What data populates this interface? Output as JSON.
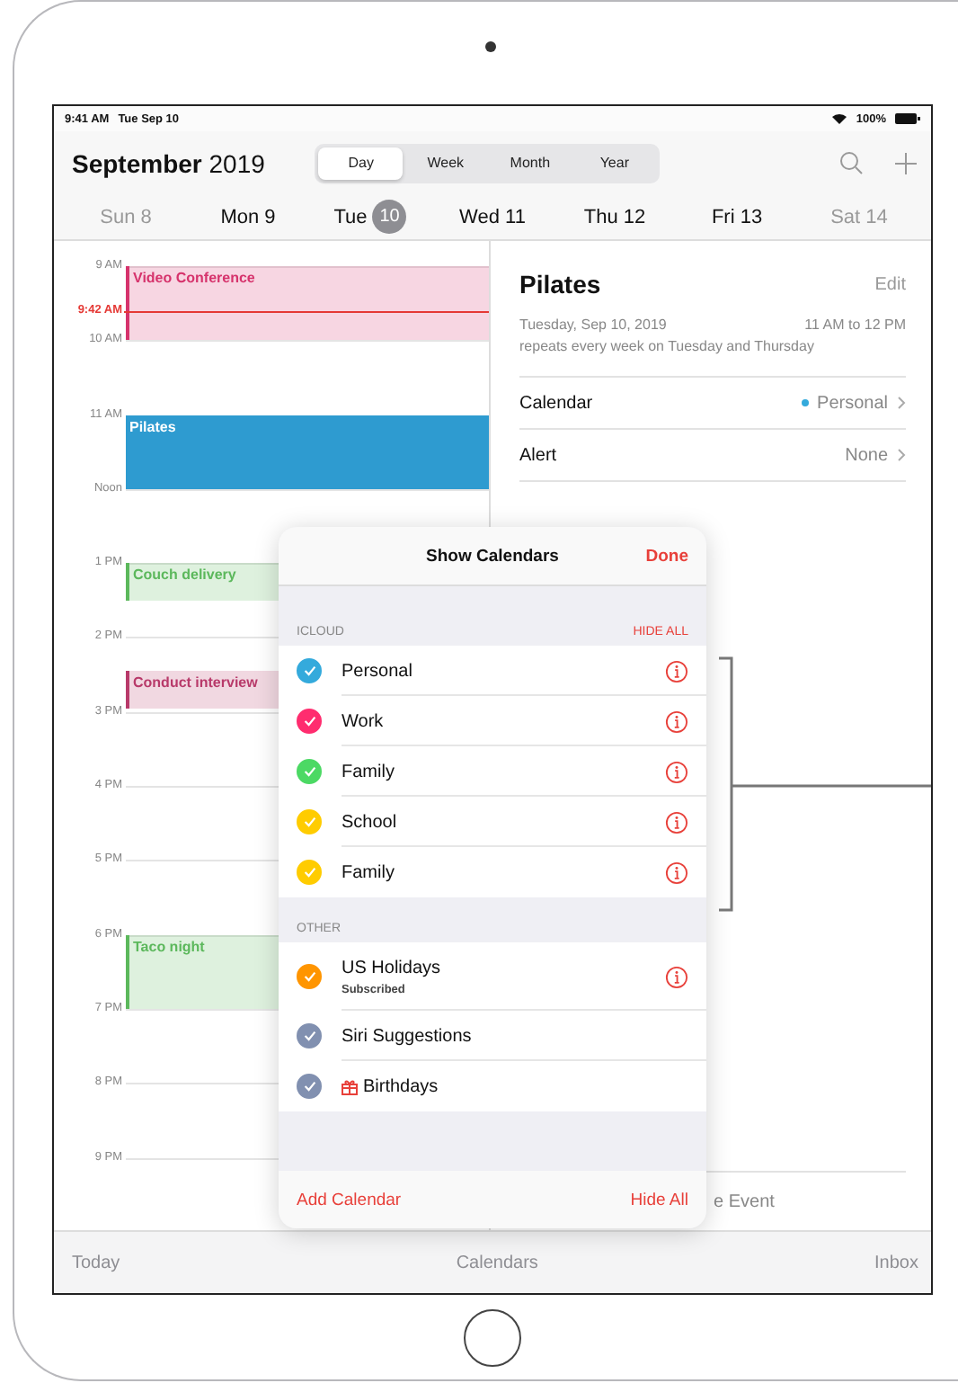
{
  "status_bar": {
    "time": "9:41 AM",
    "date": "Tue Sep 10",
    "battery": "100%"
  },
  "header": {
    "month": "September",
    "year": "2019",
    "views": [
      {
        "label": "Day",
        "selected": true
      },
      {
        "label": "Week",
        "selected": false
      },
      {
        "label": "Month",
        "selected": false
      },
      {
        "label": "Year",
        "selected": false
      }
    ]
  },
  "week": [
    {
      "day": "Sun",
      "number": "8",
      "selected": false,
      "dimmed": true
    },
    {
      "day": "Mon",
      "number": "9",
      "selected": false,
      "dimmed": false
    },
    {
      "day": "Tue",
      "number": "10",
      "selected": true,
      "dimmed": false
    },
    {
      "day": "Wed",
      "number": "11",
      "selected": false,
      "dimmed": false
    },
    {
      "day": "Thu",
      "number": "12",
      "selected": false,
      "dimmed": false
    },
    {
      "day": "Fri",
      "number": "13",
      "selected": false,
      "dimmed": false
    },
    {
      "day": "Sat",
      "number": "14",
      "selected": false,
      "dimmed": true
    }
  ],
  "timeline": {
    "hours": [
      {
        "label": "9 AM",
        "now": "9:42 AM",
        "events": [
          {
            "title": "Video Conference",
            "color": "#d6336c",
            "kind": "tinted",
            "short": false,
            "starts_half_past": false
          }
        ]
      },
      {
        "label": "10 AM"
      },
      {
        "label": "11 AM",
        "events": [
          {
            "title": "Pilates",
            "color": "#2e9bd0",
            "kind": "filled",
            "short": false,
            "starts_half_past": false
          }
        ]
      },
      {
        "label": "Noon"
      },
      {
        "label": "1 PM",
        "events": [
          {
            "title": "Couch delivery",
            "color": "#5cb85c",
            "kind": "tinted",
            "short": true,
            "starts_half_past": false
          }
        ]
      },
      {
        "label": "2 PM",
        "events": [
          {
            "title": "Conduct interview",
            "color": "#b83a6a",
            "kind": "tinted",
            "short": true,
            "starts_half_past": true
          }
        ]
      },
      {
        "label": "3 PM"
      },
      {
        "label": "4 PM"
      },
      {
        "label": "5 PM"
      },
      {
        "label": "6 PM",
        "events": [
          {
            "title": "Taco night",
            "color": "#5cb85c",
            "kind": "tinted",
            "short": false,
            "starts_half_past": false
          }
        ]
      },
      {
        "label": "7 PM"
      },
      {
        "label": "8 PM"
      },
      {
        "label": "9 PM"
      }
    ]
  },
  "detail": {
    "title": "Pilates",
    "edit": "Edit",
    "date": "Tuesday, Sep 10, 2019",
    "time": "11 AM to 12 PM",
    "repeat": "repeats every week on Tuesday and Thursday",
    "rows": [
      {
        "label": "Calendar",
        "value": "Personal",
        "color": "#34aadc"
      },
      {
        "label": "Alert",
        "value": "None"
      }
    ],
    "footer": "e Event"
  },
  "popover": {
    "title": "Show Calendars",
    "done": "Done",
    "sections": [
      {
        "name": "ICLOUD",
        "action": "HIDE ALL",
        "rows": [
          {
            "label": "Personal",
            "color": "#34aadc",
            "checked": true,
            "kind": "info"
          },
          {
            "label": "Work",
            "color": "#ff2d6f",
            "checked": true,
            "kind": "info"
          },
          {
            "label": "Family",
            "color": "#4cd964",
            "checked": true,
            "kind": "info"
          },
          {
            "label": "School",
            "color": "#ffcc00",
            "checked": true,
            "kind": "info"
          },
          {
            "label": "Family",
            "color": "#ffcc00",
            "checked": true,
            "kind": "info"
          }
        ]
      },
      {
        "name": "OTHER",
        "rows": [
          {
            "label": "US Holidays",
            "subtitle": "Subscribed",
            "color": "#ff9500",
            "checked": true,
            "kind": "info"
          },
          {
            "label": "Siri Suggestions",
            "color": "#8190b0",
            "checked": true,
            "kind": "plain"
          },
          {
            "label": "Birthdays",
            "color": "#8190b0",
            "checked": true,
            "kind": "gift"
          }
        ]
      }
    ],
    "add": "Add Calendar",
    "hide_all": "Hide All"
  },
  "tab_bar": [
    {
      "label": "Today"
    },
    {
      "label": "Calendars"
    },
    {
      "label": "Inbox"
    }
  ]
}
